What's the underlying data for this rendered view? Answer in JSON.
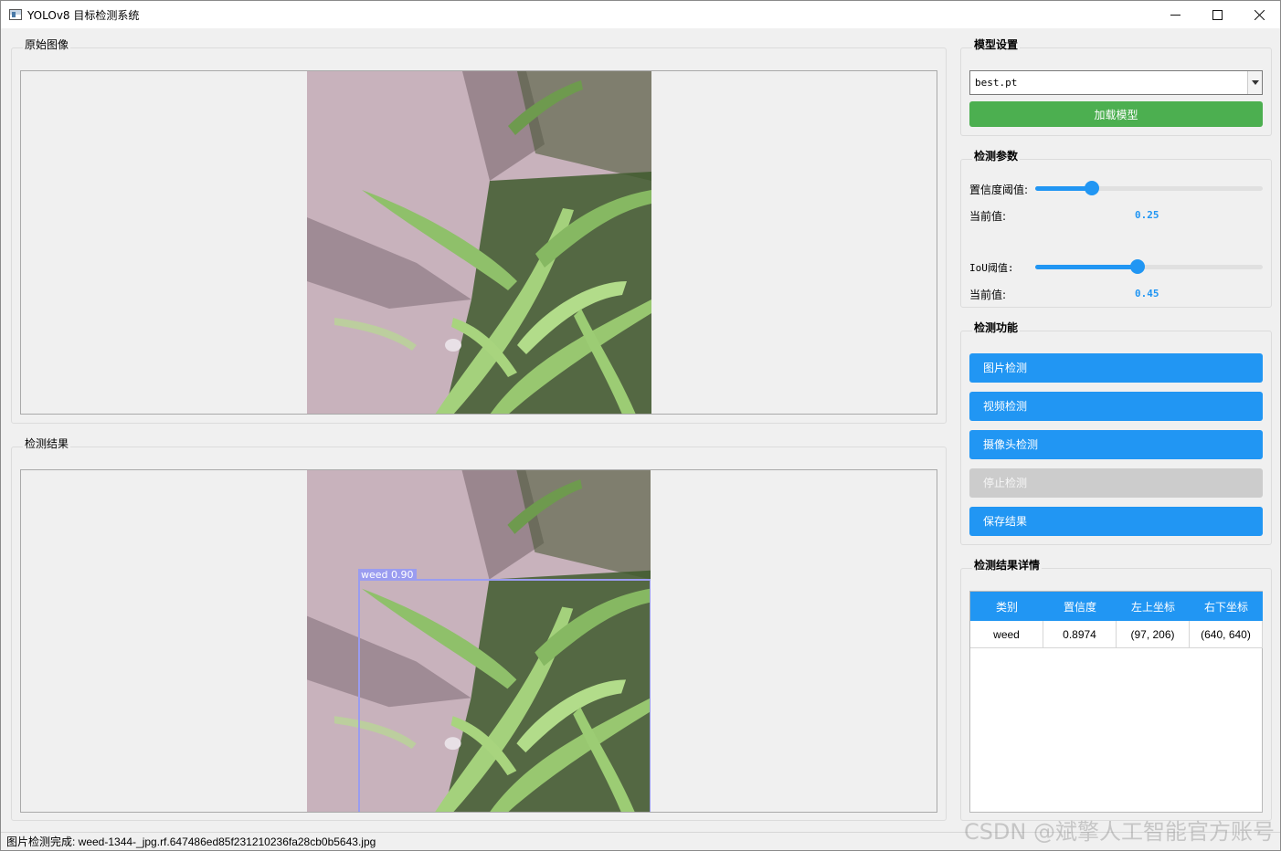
{
  "window": {
    "title": "YOLOv8 目标检测系统",
    "icons": {
      "minimize": "minimize-icon",
      "maximize": "maximize-icon",
      "close": "close-icon"
    }
  },
  "panels": {
    "original": {
      "title": "原始图像"
    },
    "result": {
      "title": "检测结果",
      "detection": {
        "label": "weed  0.90"
      }
    }
  },
  "model_settings": {
    "title": "模型设置",
    "model_select_value": "best.pt",
    "load_button": "加载模型"
  },
  "detect_params": {
    "title": "检测参数",
    "confidence": {
      "label": "置信度阈值:",
      "current_label": "当前值:",
      "value": "0.25",
      "fraction": 0.25
    },
    "iou": {
      "label": "IoU阈值:",
      "current_label": "当前值:",
      "value": "0.45",
      "fraction": 0.45
    }
  },
  "detect_functions": {
    "title": "检测功能",
    "buttons": [
      "图片检测",
      "视频检测",
      "摄像头检测",
      "停止检测",
      "保存结果"
    ]
  },
  "result_details": {
    "title": "检测结果详情",
    "columns": [
      "类别",
      "置信度",
      "左上坐标",
      "右下坐标"
    ],
    "rows": [
      [
        "weed",
        "0.8974",
        "(97, 206)",
        "(640, 640)"
      ]
    ]
  },
  "status": {
    "text": "图片检测完成: weed-1344-_jpg.rf.647486ed85f231210236fa28cb0b5643.jpg"
  },
  "watermark": "CSDN @斌擎人工智能官方账号",
  "colors": {
    "accent": "#2196f3",
    "green": "#4caf50",
    "disabled": "#cccccc",
    "detection": "#9a9cf0"
  }
}
